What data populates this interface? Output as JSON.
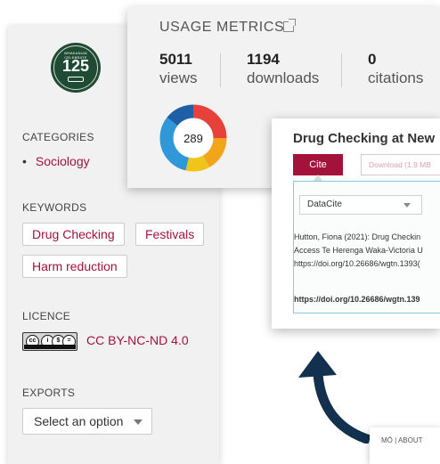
{
  "sidebar": {
    "logo": {
      "top_text": "WHAKANUIA",
      "sub_text": "CELEBRATE",
      "number": "125",
      "colors": {
        "bg": "#1f4a33"
      }
    },
    "categories": {
      "title": "CATEGORIES",
      "items": [
        "Sociology"
      ]
    },
    "keywords": {
      "title": "KEYWORDS",
      "tags": [
        "Drug Checking",
        "Festivals",
        "Harm reduction"
      ]
    },
    "licence": {
      "title": "LICENCE",
      "name": "CC BY-NC-ND 4.0",
      "badge_text": "BY NC ND"
    },
    "exports": {
      "title": "EXPORTS",
      "select_value": "Select an option"
    }
  },
  "metrics": {
    "title": "USAGE METRICS",
    "items": [
      {
        "value": "5011",
        "label": "views"
      },
      {
        "value": "1194",
        "label": "downloads"
      },
      {
        "value": "0",
        "label": "citations"
      }
    ],
    "altmetric_score": "289"
  },
  "dataset": {
    "title": "Drug Checking at New",
    "cite_label": "Cite",
    "download_label": "Download (1.9 MB",
    "citation_style": "DataCite",
    "citation_lines": [
      "Hutton, Fiona (2021): Drug Checkin",
      "Access Te Herenga Waka-Victoria U",
      "https://doi.org/10.26686/wgtn.1393("
    ],
    "doi": "https://doi.org/10.26686/wgtn.139"
  },
  "footer": {
    "text": "MŌ | ABOUT"
  },
  "colors": {
    "accent": "#a3123a",
    "arrow": "#13304f"
  }
}
